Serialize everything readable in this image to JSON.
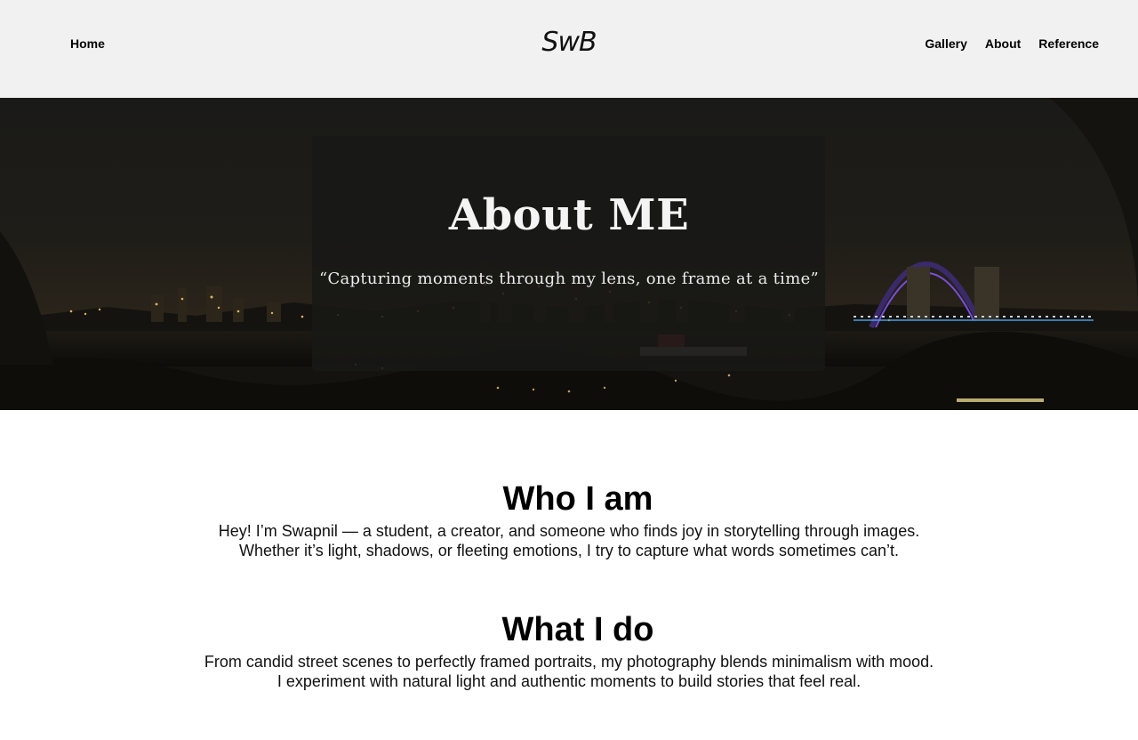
{
  "header": {
    "logo": "SwB",
    "nav_left": {
      "home": "Home"
    },
    "nav_right": {
      "gallery": "Gallery",
      "about": "About",
      "reference": "Reference"
    }
  },
  "hero": {
    "title": "About ME",
    "quote": "“Capturing moments through my lens, one frame at a time”"
  },
  "sections": [
    {
      "title": "Who I am",
      "lines": [
        "Hey! I’m Swapnil — a student, a creator, and someone who finds joy in storytelling through images.",
        "Whether it’s light, shadows, or fleeting emotions, I try to capture what words sometimes can’t."
      ]
    },
    {
      "title": "What I do",
      "lines": [
        "From candid street scenes to perfectly framed portraits, my photography blends minimalism with mood.",
        "I experiment with natural light and authentic moments to build stories that feel real."
      ]
    }
  ],
  "colors": {
    "header_bg": "#f1f1f1",
    "hero_overlay": "#181816",
    "text": "#000000"
  }
}
